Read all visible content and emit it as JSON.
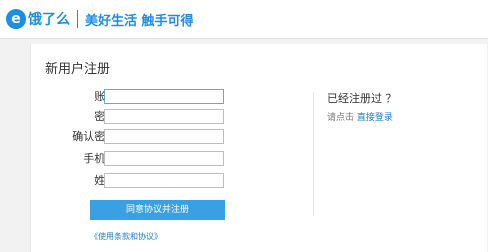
{
  "header": {
    "logo_mark": "e",
    "logo_text": "饿了么",
    "slogan": "美好生活 触手可得"
  },
  "form": {
    "title": "新用户注册",
    "fields": [
      {
        "label": "账号:",
        "value": ""
      },
      {
        "label": "密码:",
        "value": ""
      },
      {
        "label": "确认密码:",
        "value": ""
      },
      {
        "label": "手机号:",
        "value": ""
      },
      {
        "label": "姓名:",
        "value": ""
      }
    ],
    "submit_label": "同意协议并注册",
    "terms_link": "《使用条款和协议》"
  },
  "side": {
    "already_registered": "已经注册过 ？",
    "hint_prefix": "请点击",
    "login_link": "直接登录"
  },
  "colors": {
    "brand": "#1b8ee8",
    "button": "#3aa0e4",
    "link": "#1b7fd0"
  }
}
